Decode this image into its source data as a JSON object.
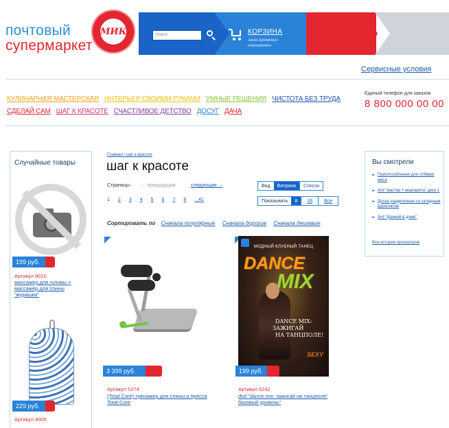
{
  "header": {
    "logo_line1": "почтовый",
    "logo_line2": "супермаркет",
    "seal_text": "МИКС",
    "search_placeholder": "поиск",
    "cart_title": "КОРЗИНА",
    "cart_subtitle": "заказ временно невозможен",
    "service_link": "Сервисные условия"
  },
  "categories": [
    {
      "label": "КУЛИНАРНАЯ МАСТЕРСКАЯ",
      "color": "#f7a21b"
    },
    {
      "label": "ИНТЕРЬЕР СВОИМИ РУКАМИ",
      "color": "#f2c11a"
    },
    {
      "label": "УМНЫЕ РЕШЕНИЯ",
      "color": "#8cc63e"
    },
    {
      "label": "ЧИСТОТА БЕЗ ТРУДА",
      "color": "#1a5aa6"
    },
    {
      "label": "СДЕЛАЙ САМ",
      "color": "#e3262f"
    },
    {
      "label": "ШАГ К КРАСОТЕ",
      "color": "#d0357a"
    },
    {
      "label": "СЧАСТЛИВОЕ ДЕТСТВО",
      "color": "#8a3fa8"
    },
    {
      "label": "ДОСУГ",
      "color": "#2a83d8"
    },
    {
      "label": "ДАЧА",
      "color": "#e3262f"
    }
  ],
  "phone": {
    "label": "Единый телефон для заказов",
    "number": "8 800 000 00 00"
  },
  "left_sidebar": {
    "title": "Случайные товары",
    "items": [
      {
        "price": "199 руб.",
        "article": "Артикул 8010",
        "desc": "массажер для головы + массажер для спины \"мурашки\""
      },
      {
        "price": "229 руб.",
        "article": "Артикул 4005"
      }
    ]
  },
  "main": {
    "breadcrumb": "Главная / шаг к красоте",
    "title": "шаг к красоте",
    "pages_label": "Страницы:",
    "prev": "← предыдущая",
    "next": "следующая →",
    "page_numbers": [
      "1",
      "2",
      "3",
      "4",
      "5",
      "6",
      "7",
      "8",
      "...41"
    ],
    "view_label": "Вид",
    "view_active": "Витрина",
    "view_inactive": "Список",
    "show_label": "Показывать",
    "show_active": "8",
    "show_16": "16",
    "show_all": "Все",
    "sort_label": "Сортировать по",
    "sort_options": [
      "Сначала популярные",
      "Сначала дорогие",
      "Сначала дешевые"
    ]
  },
  "products": [
    {
      "price": "3 399 руб.",
      "article": "Артикул 5274",
      "desc": "(Total Core) тренажер для спины и пресса Total Core"
    },
    {
      "price": "199 руб.",
      "article": "Артикул 5242",
      "desc": "dvd \"dance mix: зажигай на танцполе! базовый уровень\""
    }
  ],
  "dvd_cover": {
    "top": "МОДНЫЙ КЛУБНЫЙ ТАНЕЦ",
    "dance": "DANCE",
    "mix": "MIX",
    "sub1": "DANCE MIX:",
    "sub2": "ЗАЖИГАЙ",
    "sub3": "НА ТАНЦПОЛЕ!",
    "sexy": "SEXY"
  },
  "right_sidebar": {
    "title": "Вы смотрели",
    "items": [
      "Приспособления для отбивки мяса",
      "dvd \"мастер + маргарита\" диск 1",
      "Доска разделочная со складным дуршлагом",
      "dvd \"фанкий в доме\""
    ],
    "history": "Вся история просмотров"
  }
}
